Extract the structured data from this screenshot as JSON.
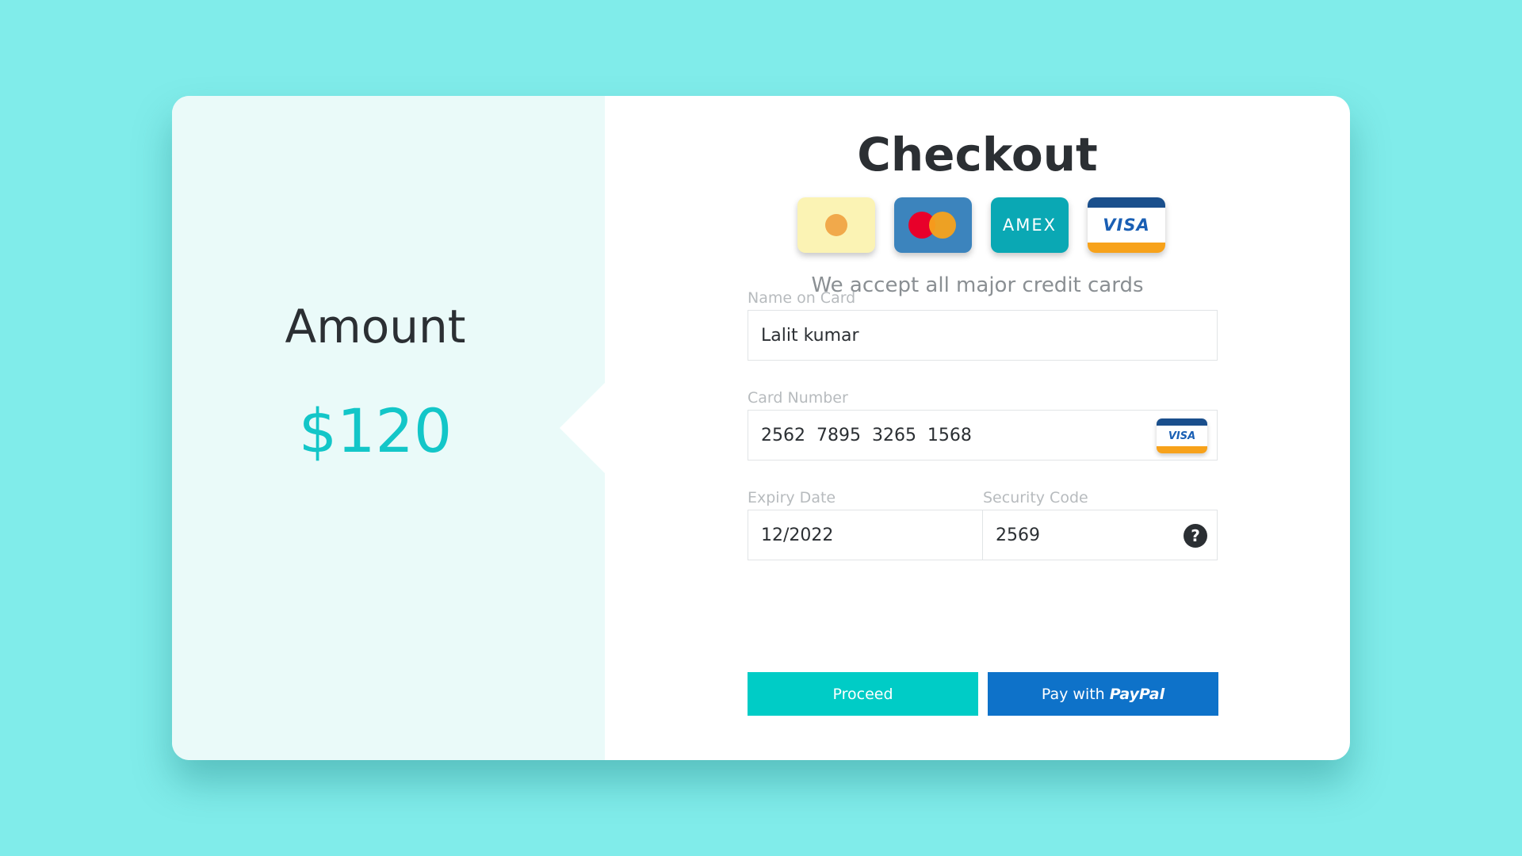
{
  "amount": {
    "label": "Amount",
    "value": "$120"
  },
  "checkout": {
    "title": "Checkout",
    "accepted_cards": [
      {
        "name": "generic-card-icon"
      },
      {
        "name": "mastercard-icon"
      },
      {
        "name": "amex-icon",
        "text": "AMEX"
      },
      {
        "name": "visa-icon",
        "text": "VISA"
      }
    ],
    "accept_text": "We accept all major credit cards"
  },
  "form": {
    "name_label": "Name on Card",
    "name_value": "Lalit kumar",
    "card_label": "Card Number",
    "card_value": "2562  7895  3265  1568",
    "card_brand_text": "VISA",
    "expiry_label": "Expiry Date",
    "expiry_value": "12/2022",
    "security_label": "Security Code",
    "security_value": "2569",
    "help_glyph": "?"
  },
  "buttons": {
    "proceed_label": "Proceed",
    "paypal_prefix": "Pay with",
    "paypal_brand": "PayPal"
  },
  "colors": {
    "background": "#80ecea",
    "accent": "#00ccc6",
    "amount": "#13c6c8",
    "paypal": "#0e72c9"
  }
}
